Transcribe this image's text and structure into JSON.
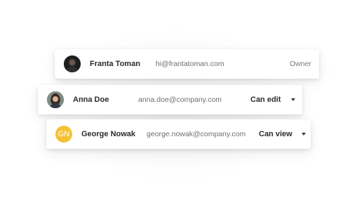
{
  "users": [
    {
      "name": "Franta Toman",
      "email": "hi@frantatoman.com",
      "role": "Owner"
    },
    {
      "name": "Anna Doe",
      "email": "anna.doe@company.com",
      "permission": "Can edit"
    },
    {
      "name": "George Nowak",
      "email": "george.nowak@company.com",
      "permission": "Can view",
      "initials": "GN",
      "avatar_color": "#f5c234"
    }
  ]
}
